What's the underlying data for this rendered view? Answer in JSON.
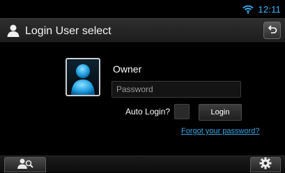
{
  "status_bar": {
    "clock": "12:11",
    "wifi_icon": "wifi-icon",
    "accent_color": "#3fb6ff"
  },
  "header": {
    "title": "Login User select",
    "user_icon": "user-icon",
    "back_icon": "back-arrow-icon"
  },
  "login": {
    "avatar_icon": "user-avatar-icon",
    "user_name": "Owner",
    "password_placeholder": "Password",
    "password_value": "",
    "auto_login_label": "Auto Login?",
    "auto_login_checked": false,
    "login_label": "Login",
    "forgot_link": "Forgot your password?",
    "link_color": "#3aa6e8"
  },
  "footer": {
    "left_icon": "user-search-icon",
    "right_icon": "gear-icon"
  }
}
